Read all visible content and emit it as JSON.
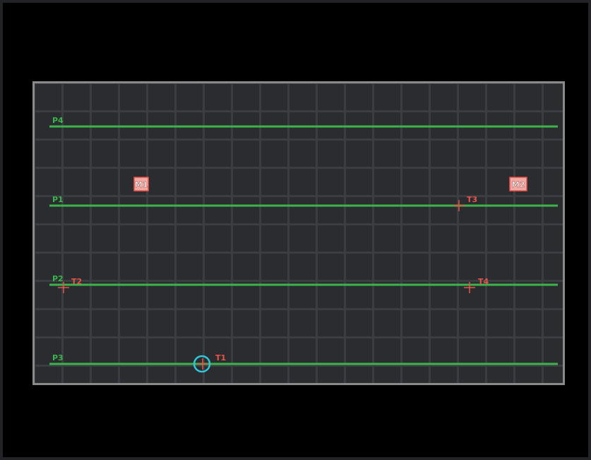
{
  "colors": {
    "background": "#000000",
    "arena": "#2a2c30",
    "grid": "#3a3d42",
    "border": "#8a8a8a",
    "platform": "#3cb44b",
    "target": "#e8544a",
    "marker_fill": "#f3a9a3",
    "player": "#2ec8d8"
  },
  "platforms": [
    {
      "label": "P4"
    },
    {
      "label": "P1"
    },
    {
      "label": "P2"
    },
    {
      "label": "P3"
    }
  ],
  "targets": [
    {
      "label": "T1"
    },
    {
      "label": "T2"
    },
    {
      "label": "T3"
    },
    {
      "label": "T4"
    }
  ],
  "markers": [
    {
      "label": "M1"
    },
    {
      "label": "M2"
    }
  ],
  "player": {
    "icon": "circle-cursor-icon"
  }
}
